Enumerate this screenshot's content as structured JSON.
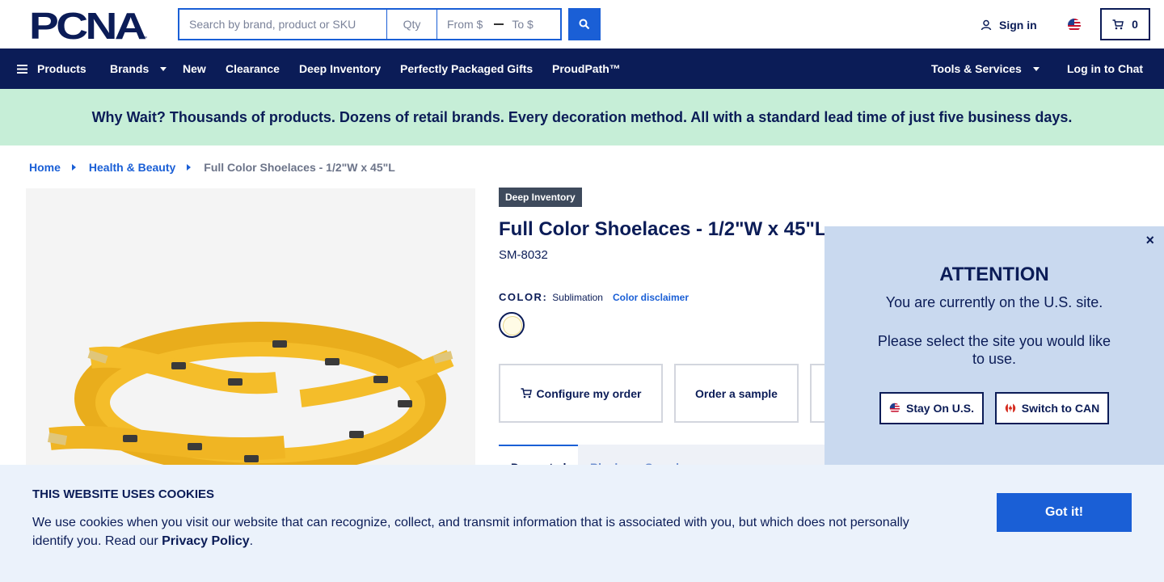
{
  "header": {
    "logo_text": "PCNA",
    "search": {
      "placeholder": "Search by brand, product or SKU",
      "qty_placeholder": "Qty",
      "from_placeholder": "From $",
      "to_placeholder": "To $"
    },
    "signin_label": "Sign in",
    "cart_count": "0"
  },
  "nav": {
    "items": [
      {
        "label": "Products",
        "icon": "menu-icon"
      },
      {
        "label": "Brands",
        "has_dropdown": true
      },
      {
        "label": "New"
      },
      {
        "label": "Clearance"
      },
      {
        "label": "Deep Inventory"
      },
      {
        "label": "Perfectly Packaged Gifts"
      },
      {
        "label": "ProudPath™"
      }
    ],
    "right_items": [
      {
        "label": "Tools & Services",
        "has_dropdown": true
      },
      {
        "label": "Log in to Chat"
      }
    ]
  },
  "promo": {
    "text": "Why Wait? Thousands of products. Dozens of retail brands. Every decoration method. All with a standard lead time of just five business days."
  },
  "breadcrumb": [
    "Home",
    "Health & Beauty",
    "Full Color Shoelaces - 1/2\"W x 45\"L"
  ],
  "product": {
    "badge": "Deep Inventory",
    "title": "Full Color Shoelaces - 1/2\"W x 45\"L",
    "sku": "SM-8032",
    "color_label": "COLOR:",
    "color_value": "Sublimation",
    "color_disclaimer": "Color disclaimer",
    "actions": {
      "configure": "Configure my order",
      "sample": "Order a sample"
    },
    "tabs": [
      "Decorated",
      "Blank",
      "Samples"
    ]
  },
  "modal": {
    "close": "×",
    "title": "ATTENTION",
    "line1": "You are currently on the U.S. site.",
    "line2": "Please select the site you would like to use.",
    "stay_label": "Stay On U.S.",
    "switch_label": "Switch to CAN"
  },
  "cookie": {
    "title": "THIS WEBSITE USES COOKIES",
    "text": "We use cookies when you visit our website that can recognize, collect, and transmit information that is associated with you, but which does not personally identify you. Read our",
    "link": "Privacy Policy",
    "end": ".",
    "button": "Got it!"
  },
  "colors": {
    "navy": "#0b1c57",
    "blue": "#1a5fd6",
    "promo_bg": "#c6eed7",
    "modal_bg": "#c9d9ef",
    "cookie_bg": "#ebf2fb"
  }
}
